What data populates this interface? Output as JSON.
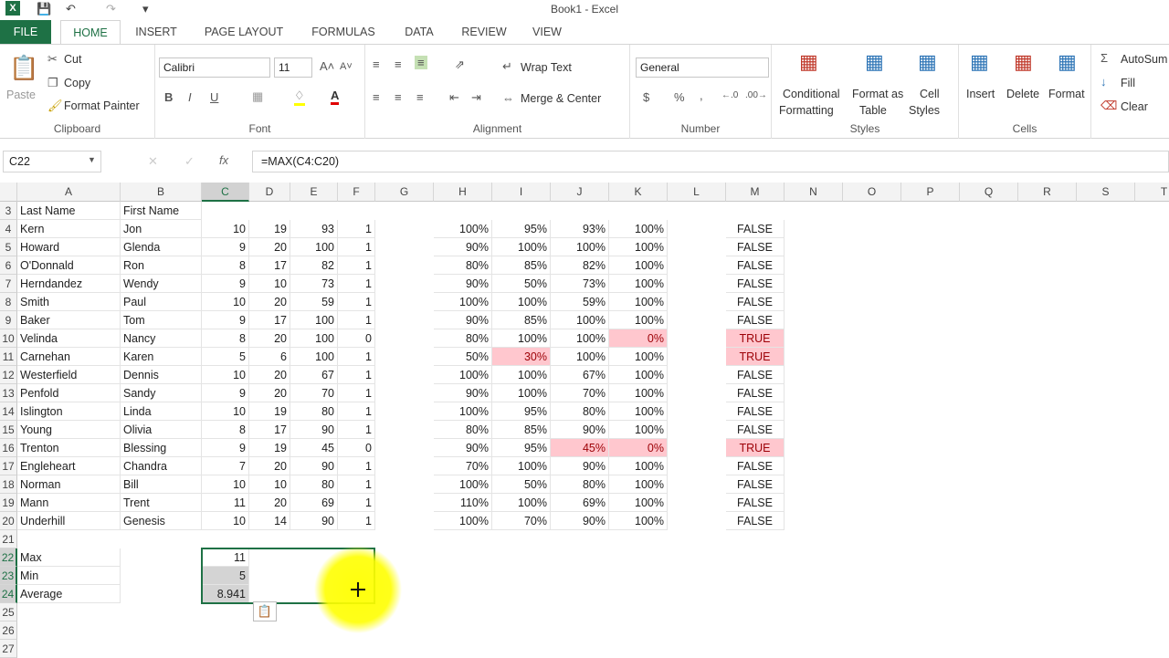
{
  "window": {
    "title": "Book1 - Excel"
  },
  "tabs": [
    "FILE",
    "HOME",
    "INSERT",
    "PAGE LAYOUT",
    "FORMULAS",
    "DATA",
    "REVIEW",
    "VIEW"
  ],
  "ribbon": {
    "clipboard": {
      "paste": "Paste",
      "cut": "Cut",
      "copy": "Copy",
      "format_painter": "Format Painter",
      "label": "Clipboard"
    },
    "font": {
      "name": "Calibri",
      "size": "11",
      "label": "Font"
    },
    "alignment": {
      "wrap": "Wrap Text",
      "merge": "Merge & Center",
      "label": "Alignment"
    },
    "number": {
      "format": "General",
      "label": "Number"
    },
    "styles": {
      "conditional": "Conditional",
      "conditional2": "Formatting",
      "format_as": "Format as",
      "format_as2": "Table",
      "cell": "Cell",
      "cell2": "Styles",
      "label": "Styles"
    },
    "cells": {
      "insert": "Insert",
      "delete": "Delete",
      "format": "Format",
      "label": "Cells"
    },
    "editing": {
      "autosum": "AutoSum",
      "fill": "Fill",
      "clear": "Clear"
    }
  },
  "formula_bar": {
    "cell": "C22",
    "formula": "=MAX(C4:C20)"
  },
  "columns": [
    "A",
    "B",
    "C",
    "D",
    "E",
    "F",
    "G",
    "H",
    "I",
    "J",
    "K",
    "L",
    "M",
    "N",
    "O",
    "P",
    "Q",
    "R",
    "S",
    "T"
  ],
  "header_row": {
    "row": "3",
    "a": "Last Name",
    "b": "First Name"
  },
  "rows": [
    {
      "r": "4",
      "a": "Kern",
      "b": "Jon",
      "c": "10",
      "cd": "green",
      "d": "19",
      "dd": "green",
      "e": "93",
      "ed": "green",
      "f": "1",
      "fd": "green",
      "h": "100%",
      "i": "95%",
      "j": "93%",
      "k": "100%",
      "m": "FALSE"
    },
    {
      "r": "5",
      "a": "Howard",
      "b": "Glenda",
      "c": "9",
      "cd": "yellow",
      "d": "20",
      "dd": "green",
      "e": "100",
      "ed": "green",
      "f": "1",
      "fd": "green",
      "h": "90%",
      "i": "100%",
      "j": "100%",
      "k": "100%",
      "m": "FALSE"
    },
    {
      "r": "6",
      "a": "O'Donnald",
      "b": "Ron",
      "c": "8",
      "cd": "yellow",
      "d": "17",
      "dd": "green",
      "e": "82",
      "ed": "yellow",
      "f": "1",
      "fd": "green",
      "h": "80%",
      "i": "85%",
      "j": "82%",
      "k": "100%",
      "m": "FALSE"
    },
    {
      "r": "7",
      "a": "Herndandez",
      "b": "Wendy",
      "c": "9",
      "cd": "yellow",
      "d": "10",
      "dd": "red",
      "e": "73",
      "ed": "yellow",
      "f": "1",
      "fd": "green",
      "h": "90%",
      "i": "50%",
      "j": "73%",
      "k": "100%",
      "m": "FALSE"
    },
    {
      "r": "8",
      "a": "Smith",
      "b": "Paul",
      "c": "10",
      "cd": "green",
      "d": "20",
      "dd": "green",
      "e": "59",
      "ed": "red",
      "f": "1",
      "fd": "green",
      "h": "100%",
      "i": "100%",
      "j": "59%",
      "k": "100%",
      "m": "FALSE"
    },
    {
      "r": "9",
      "a": "Baker",
      "b": "Tom",
      "c": "9",
      "cd": "yellow",
      "d": "17",
      "dd": "green",
      "e": "100",
      "ed": "green",
      "f": "1",
      "fd": "green",
      "h": "90%",
      "i": "85%",
      "j": "100%",
      "k": "100%",
      "m": "FALSE"
    },
    {
      "r": "10",
      "a": "Velinda",
      "b": "Nancy",
      "c": "8",
      "cd": "yellow",
      "d": "20",
      "dd": "green",
      "e": "100",
      "ed": "green",
      "f": "0",
      "fd": "black",
      "h": "80%",
      "i": "100%",
      "j": "100%",
      "k": "0%",
      "kp": true,
      "m": "TRUE",
      "mp": true
    },
    {
      "r": "11",
      "a": "Carnehan",
      "b": "Karen",
      "c": "5",
      "cd": "black",
      "d": "6",
      "dd": "black",
      "e": "100",
      "ed": "green",
      "f": "1",
      "fd": "green",
      "h": "50%",
      "i": "30%",
      "ip": true,
      "j": "100%",
      "k": "100%",
      "m": "TRUE",
      "mp": true
    },
    {
      "r": "12",
      "a": "Westerfield",
      "b": "Dennis",
      "c": "10",
      "cd": "green",
      "d": "20",
      "dd": "green",
      "e": "67",
      "ed": "red",
      "f": "1",
      "fd": "green",
      "h": "100%",
      "i": "100%",
      "j": "67%",
      "k": "100%",
      "m": "FALSE"
    },
    {
      "r": "13",
      "a": "Penfold",
      "b": "Sandy",
      "c": "9",
      "cd": "yellow",
      "d": "20",
      "dd": "green",
      "e": "70",
      "ed": "red",
      "f": "1",
      "fd": "green",
      "h": "90%",
      "i": "100%",
      "j": "70%",
      "k": "100%",
      "m": "FALSE"
    },
    {
      "r": "14",
      "a": "Islington",
      "b": "Linda",
      "c": "10",
      "cd": "green",
      "d": "19",
      "dd": "green",
      "e": "80",
      "ed": "yellow",
      "f": "1",
      "fd": "green",
      "h": "100%",
      "i": "95%",
      "j": "80%",
      "k": "100%",
      "m": "FALSE"
    },
    {
      "r": "15",
      "a": "Young",
      "b": "Olivia",
      "c": "8",
      "cd": "yellow",
      "d": "17",
      "dd": "green",
      "e": "90",
      "ed": "green",
      "f": "1",
      "fd": "green",
      "h": "80%",
      "i": "85%",
      "j": "90%",
      "k": "100%",
      "m": "FALSE"
    },
    {
      "r": "16",
      "a": "Trenton",
      "b": "Blessing",
      "c": "9",
      "cd": "yellow",
      "d": "19",
      "dd": "green",
      "e": "45",
      "ed": "black",
      "f": "0",
      "fd": "black",
      "h": "90%",
      "i": "95%",
      "j": "45%",
      "jp": true,
      "k": "0%",
      "kp": true,
      "m": "TRUE",
      "mp": true
    },
    {
      "r": "17",
      "a": "Engleheart",
      "b": "Chandra",
      "c": "7",
      "cd": "red",
      "d": "20",
      "dd": "green",
      "e": "90",
      "ed": "green",
      "f": "1",
      "fd": "green",
      "h": "70%",
      "i": "100%",
      "j": "90%",
      "k": "100%",
      "m": "FALSE"
    },
    {
      "r": "18",
      "a": "Norman",
      "b": "Bill",
      "c": "10",
      "cd": "green",
      "d": "10",
      "dd": "red",
      "e": "80",
      "ed": "yellow",
      "f": "1",
      "fd": "green",
      "h": "100%",
      "i": "50%",
      "j": "80%",
      "k": "100%",
      "m": "FALSE"
    },
    {
      "r": "19",
      "a": "Mann",
      "b": "Trent",
      "c": "11",
      "cd": "green",
      "d": "20",
      "dd": "green",
      "e": "69",
      "ed": "red",
      "f": "1",
      "fd": "green",
      "h": "110%",
      "i": "100%",
      "j": "69%",
      "k": "100%",
      "m": "FALSE"
    },
    {
      "r": "20",
      "a": "Underhill",
      "b": "Genesis",
      "c": "10",
      "cd": "green",
      "d": "14",
      "dd": "yellow",
      "e": "90",
      "ed": "green",
      "f": "1",
      "fd": "green",
      "h": "100%",
      "i": "70%",
      "j": "90%",
      "k": "100%",
      "m": "FALSE"
    }
  ],
  "summary": [
    {
      "r": "22",
      "label": "Max",
      "value": "11"
    },
    {
      "r": "23",
      "label": "Min",
      "value": "5"
    },
    {
      "r": "24",
      "label": "Average",
      "value": "8.941"
    }
  ],
  "blank_rows": [
    "21",
    "25",
    "26",
    "27"
  ],
  "colors": {
    "excel_green": "#1e7145",
    "highlight_yellow": "#ffff00",
    "bad_fill": "#ffc7ce"
  }
}
